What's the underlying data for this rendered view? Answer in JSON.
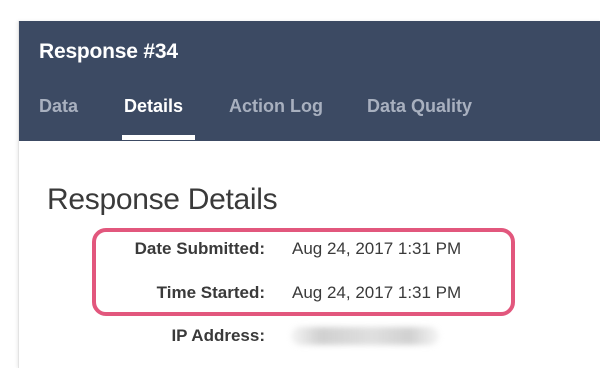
{
  "header": {
    "title": "Response #34",
    "tabs": [
      {
        "label": "Data",
        "active": false
      },
      {
        "label": "Details",
        "active": true
      },
      {
        "label": "Action Log",
        "active": false
      },
      {
        "label": "Data Quality",
        "active": false
      }
    ],
    "background_color": "#3c4a63"
  },
  "content": {
    "title": "Response Details",
    "rows": [
      {
        "label": "Date Submitted:",
        "value": "Aug 24, 2017 1:31 PM"
      },
      {
        "label": "Time Started:",
        "value": "Aug 24, 2017 1:31 PM"
      },
      {
        "label": "IP Address:",
        "value": ""
      }
    ]
  },
  "highlight_color": "#e2577d"
}
